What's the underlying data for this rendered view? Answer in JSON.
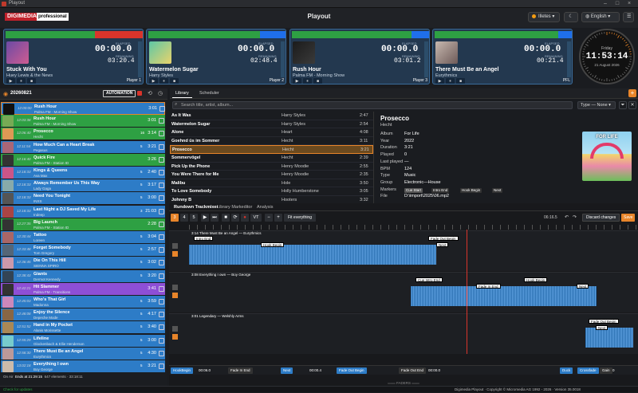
{
  "window": {
    "title": "Playout"
  },
  "header": {
    "logo": "DIGIMEDIA",
    "edition": "professional",
    "title": "Playout",
    "station": "Illetes",
    "language": "English"
  },
  "colors": {
    "accent": "#e8852a",
    "green": "#2ea043",
    "blue": "#1f6feb",
    "red": "#d9342b",
    "purple": "#8e4fd6"
  },
  "players": [
    {
      "title": "Stuck With You",
      "artist": "Huey Lewis & the News",
      "elapsed_label": "ELAPSED",
      "elapsed": "00:00.0",
      "remain_label": "REMAINING",
      "remain": "03:20.4",
      "name": "Player 1"
    },
    {
      "title": "Watermelon Sugar",
      "artist": "Harry Styles",
      "elapsed_label": "ELAPSED",
      "elapsed": "00:00.0",
      "remain_label": "REMAINING",
      "remain": "02:48.4",
      "name": "Player 2"
    },
    {
      "title": "Rush Hour",
      "artist": "Palma FM - Morning Show",
      "elapsed_label": "ELAPSED",
      "elapsed": "00:00.0",
      "remain_label": "REMAINING",
      "remain": "03:01.2",
      "name": "Player 3"
    },
    {
      "title": "There Must Be an Angel",
      "artist": "Eurythmics",
      "elapsed_label": "ELAPSED",
      "elapsed": "00:00.0",
      "remain_label": "REMAINING",
      "remain": "00:21.4",
      "name": "PFL"
    }
  ],
  "clock": {
    "day": "Friday",
    "time": "11:53:14",
    "date": "21 August 2026"
  },
  "rundown": {
    "date": "20260821",
    "automation": "AUTOMATION",
    "footer_onair": "On Air",
    "footer_end": "Ends at 21:29:15",
    "footer_count": "647 elements · 33:18:11",
    "items": [
      {
        "time": "12:00:00",
        "title": "Rush Hour",
        "artist": "Palma FM - Morning Show",
        "num": "",
        "dur": "3:01",
        "color": "#2d7cc7"
      },
      {
        "time": "12:03:38",
        "title": "Rush Hour",
        "artist": "Palma FM - Morning Show",
        "num": "",
        "dur": "3:01",
        "color": "#2ea043"
      },
      {
        "time": "12:06:40",
        "title": "Prosecco",
        "artist": "Hecht",
        "num": "16",
        "dur": "3:14",
        "color": "#2ea043"
      },
      {
        "time": "12:11:54",
        "title": "How Much Can a Heart Break",
        "artist": "Pegasus",
        "num": "5",
        "dur": "3:21",
        "color": "#2d7cc7"
      },
      {
        "time": "12:16:40",
        "title": "Quick Fire",
        "artist": "Palma FM - Station ID",
        "num": "",
        "dur": "3:26",
        "color": "#2ea043"
      },
      {
        "time": "12:18:33",
        "title": "Kings & Queens",
        "artist": "Ava Max",
        "num": "5",
        "dur": "2:40",
        "color": "#2d7cc7"
      },
      {
        "time": "12:18:33",
        "title": "Always Remember Us This Way",
        "artist": "Lady Gaga",
        "num": "5",
        "dur": "3:17",
        "color": "#2d7cc7"
      },
      {
        "time": "12:18:33",
        "title": "Need You Tonight",
        "artist": "INXS",
        "num": "5",
        "dur": "3:00",
        "color": "#2d7cc7"
      },
      {
        "time": "12:18:33",
        "title": "Last Night a DJ Saved My Life",
        "artist": "Indeep",
        "num": "3",
        "dur": "21:03",
        "color": "#2d7cc7"
      },
      {
        "time": "12:27:35",
        "title": "Big Launch",
        "artist": "Palma FM - Station ID",
        "num": "",
        "dur": "2:28",
        "color": "#2ea043"
      },
      {
        "time": "12:30:44",
        "title": "Tattoo",
        "artist": "Loreen",
        "num": "5",
        "dur": "3:04",
        "color": "#2d7cc7"
      },
      {
        "time": "12:33:48",
        "title": "Forget Somebody",
        "artist": "Tom Gregory",
        "num": "5",
        "dur": "2:57",
        "color": "#2d7cc7"
      },
      {
        "time": "12:36:45",
        "title": "Die On This Hill",
        "artist": "SIENNA SPIRO",
        "num": "5",
        "dur": "3:02",
        "color": "#2d7cc7"
      },
      {
        "time": "12:38:43",
        "title": "Giants",
        "artist": "Dermot Kennedy",
        "num": "5",
        "dur": "3:20",
        "color": "#2d7cc7"
      },
      {
        "time": "12:42:21",
        "title": "Hit Slammer",
        "artist": "Palma FM - Transitions",
        "num": "",
        "dur": "3:41",
        "color": "#8e4fd6"
      },
      {
        "time": "12:45:03",
        "title": "Who's That Girl",
        "artist": "Madonna",
        "num": "5",
        "dur": "3:59",
        "color": "#2d7cc7"
      },
      {
        "time": "12:48:08",
        "title": "Enjoy the Silence",
        "artist": "Depeche Mode",
        "num": "5",
        "dur": "4:17",
        "color": "#2d7cc7"
      },
      {
        "time": "12:51:52",
        "title": "Hand in My Pocket",
        "artist": "Alanis Morissette",
        "num": "5",
        "dur": "3:40",
        "color": "#2d7cc7"
      },
      {
        "time": "12:55:29",
        "title": "Lifeline",
        "artist": "Glockenbach & Ellie Henderson",
        "num": "5",
        "dur": "3:00",
        "color": "#2d7cc7"
      },
      {
        "time": "12:58:30",
        "title": "There Must Be an Angel",
        "artist": "Eurythmics",
        "num": "5",
        "dur": "4:30",
        "color": "#2d7cc7"
      },
      {
        "time": "13:02:18",
        "title": "Everything I own",
        "artist": "Boy George",
        "num": "5",
        "dur": "3:21",
        "color": "#2d7cc7"
      }
    ]
  },
  "library": {
    "tabs": [
      "Library",
      "Scheduler"
    ],
    "search_placeholder": "Search title, artist, album...",
    "type_filter": "Type — None",
    "rows": [
      {
        "title": "As It Was",
        "artist": "Harry Styles",
        "dur": "2:47"
      },
      {
        "title": "Watermelon Sugar",
        "artist": "Harry Styles",
        "dur": "2:54"
      },
      {
        "title": "Alone",
        "artist": "Heart",
        "dur": "4:08"
      },
      {
        "title": "Goehnd üs im Sommer",
        "artist": "Hecht",
        "dur": "3:11"
      },
      {
        "title": "Prosecco",
        "artist": "Hecht",
        "dur": "3:21"
      },
      {
        "title": "Sommervögel",
        "artist": "Hecht",
        "dur": "2:39"
      },
      {
        "title": "Pick Up the Phone",
        "artist": "Henry Moodie",
        "dur": "2:55"
      },
      {
        "title": "You Were There for Me",
        "artist": "Henry Moodie",
        "dur": "2:35"
      },
      {
        "title": "Malibu",
        "artist": "Hole",
        "dur": "3:50"
      },
      {
        "title": "To Love Somebody",
        "artist": "Holly Humberstone",
        "dur": "3:05"
      },
      {
        "title": "Johnny B",
        "artist": "Hooters",
        "dur": "3:32"
      }
    ]
  },
  "detail": {
    "title": "Prosecco",
    "artist": "Hecht",
    "fields": [
      [
        "Album",
        "For Life"
      ],
      [
        "Year",
        "2022"
      ],
      [
        "Duration",
        "3:21"
      ],
      [
        "Played",
        "0"
      ],
      [
        "Last played",
        "—"
      ],
      [
        "BPM",
        "124"
      ],
      [
        "Type",
        "Music"
      ],
      [
        "Group",
        "Electronic—House"
      ],
      [
        "Markers",
        ""
      ],
      [
        "File",
        "D:\\import\\2025\\06.mp2"
      ]
    ],
    "markers": [
      "Cue Start",
      "Intro End",
      "Hook Begin",
      "Next"
    ],
    "cover_text": "FOR LIFE"
  },
  "tracks": {
    "tabs": [
      "Rundown Trackmixer",
      "Library Markeditor",
      "Analysis"
    ],
    "nums": [
      "3",
      "4",
      "5"
    ],
    "vt": "VT",
    "fit": "Fit everything",
    "zoom": "06:16.5",
    "discard": "Discard changes",
    "save": "Save",
    "lanes": [
      {
        "label": "3:14  There Must Be an Angel — Eurythmics",
        "cues": [
          "Intro End",
          "Hook Begin",
          "Fade Out Begin",
          "Next"
        ]
      },
      {
        "label": "3:08  Everything I own — Boy George",
        "cues": [
          "Cue Intro End",
          "Fade In End",
          "Hook Begin",
          "Next"
        ]
      },
      {
        "label": "3:01  Legendary — Welshly Arms",
        "cues": [
          "Fade Out Begin",
          "Next"
        ]
      }
    ],
    "bottom": [
      "HookBegin",
      "00:06.0",
      "Fade In End",
      "Next",
      "00:00.4",
      "Fade Out Begin",
      "Fade Out End",
      "00:00.0",
      "Duck",
      "Crossfade",
      "Gain",
      "0"
    ],
    "faders": "FADERS"
  },
  "status": {
    "left": "Check for updates",
    "center": "Digimedia Playout · Copyright © Micromedia AG 1992 - 2026 · Version 35.0018"
  }
}
